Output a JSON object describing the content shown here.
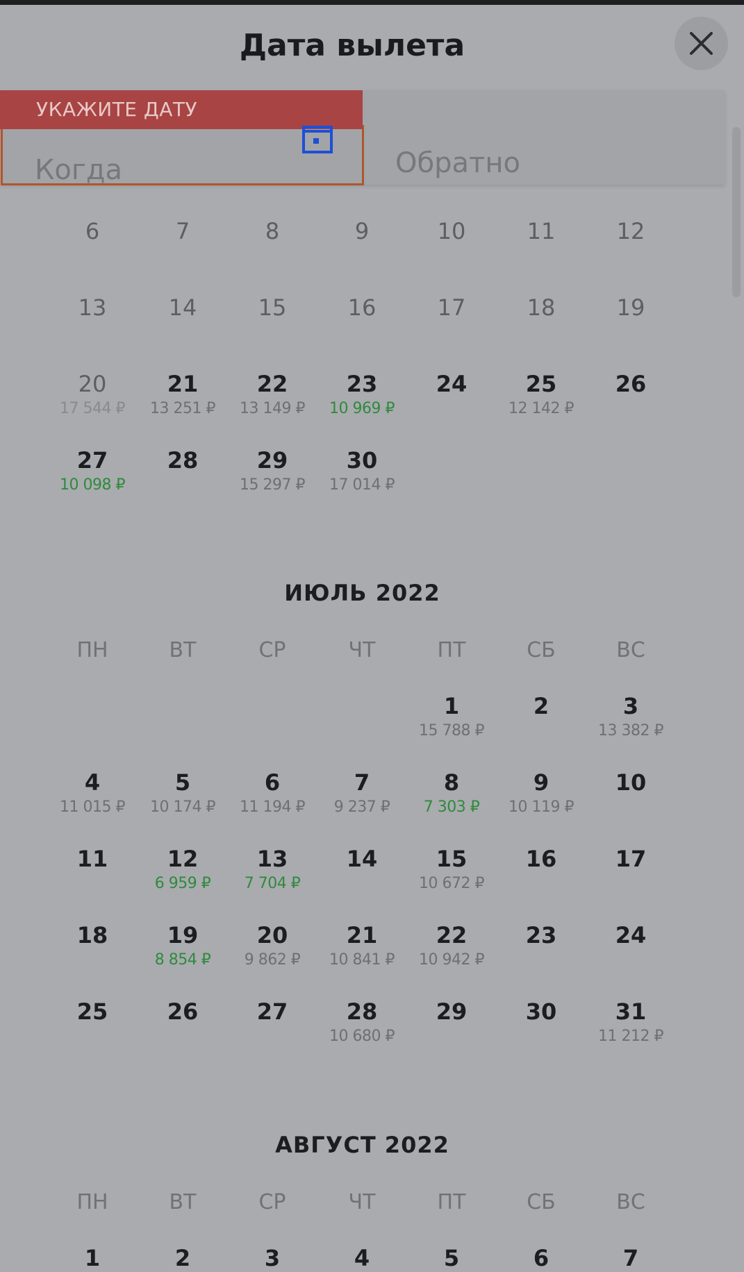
{
  "header": {
    "title": "Дата вылета",
    "close_icon": "close-icon"
  },
  "inputs": {
    "error_label": "УКАЖИТЕ ДАТУ",
    "when_placeholder": "Когда",
    "return_placeholder": "Обратно",
    "calendar_icon": "calendar-icon"
  },
  "colors": {
    "error_banner": "#a84443",
    "error_border": "#b0562d",
    "cheap_price": "#2f8a3c",
    "accent_icon": "#1d4fd7"
  },
  "june_rows": [
    [
      {
        "d": "6",
        "p": "",
        "past": true
      },
      {
        "d": "7",
        "p": "",
        "past": true
      },
      {
        "d": "8",
        "p": "",
        "past": true
      },
      {
        "d": "9",
        "p": "",
        "past": true
      },
      {
        "d": "10",
        "p": "",
        "past": true
      },
      {
        "d": "11",
        "p": "",
        "past": true
      },
      {
        "d": "12",
        "p": "",
        "past": true
      }
    ],
    [
      {
        "d": "13",
        "p": "",
        "past": true
      },
      {
        "d": "14",
        "p": "",
        "past": true
      },
      {
        "d": "15",
        "p": "",
        "past": true
      },
      {
        "d": "16",
        "p": "",
        "past": true
      },
      {
        "d": "17",
        "p": "",
        "past": true
      },
      {
        "d": "18",
        "p": "",
        "past": true
      },
      {
        "d": "19",
        "p": "",
        "past": true
      }
    ],
    [
      {
        "d": "20",
        "p": "17 544 ₽",
        "past": true,
        "ps": "faded"
      },
      {
        "d": "21",
        "p": "13 251 ₽"
      },
      {
        "d": "22",
        "p": "13 149 ₽"
      },
      {
        "d": "23",
        "p": "10 969 ₽",
        "ps": "cheap"
      },
      {
        "d": "24",
        "p": ""
      },
      {
        "d": "25",
        "p": "12 142 ₽"
      },
      {
        "d": "26",
        "p": ""
      }
    ],
    [
      {
        "d": "27",
        "p": "10 098 ₽",
        "ps": "cheap"
      },
      {
        "d": "28",
        "p": ""
      },
      {
        "d": "29",
        "p": "15 297 ₽"
      },
      {
        "d": "30",
        "p": "17 014 ₽"
      }
    ]
  ],
  "july": {
    "title": "ИЮЛЬ 2022",
    "weekdays": [
      "ПН",
      "ВТ",
      "СР",
      "ЧТ",
      "ПТ",
      "СБ",
      "ВС"
    ],
    "rows": [
      [
        null,
        null,
        null,
        null,
        {
          "d": "1",
          "p": "15 788 ₽"
        },
        {
          "d": "2",
          "p": ""
        },
        {
          "d": "3",
          "p": "13 382 ₽"
        }
      ],
      [
        {
          "d": "4",
          "p": "11 015 ₽"
        },
        {
          "d": "5",
          "p": "10 174 ₽"
        },
        {
          "d": "6",
          "p": "11 194 ₽"
        },
        {
          "d": "7",
          "p": "9 237 ₽"
        },
        {
          "d": "8",
          "p": "7 303 ₽",
          "ps": "cheap"
        },
        {
          "d": "9",
          "p": "10 119 ₽"
        },
        {
          "d": "10",
          "p": ""
        }
      ],
      [
        {
          "d": "11",
          "p": ""
        },
        {
          "d": "12",
          "p": "6 959 ₽",
          "ps": "cheap"
        },
        {
          "d": "13",
          "p": "7 704 ₽",
          "ps": "cheap"
        },
        {
          "d": "14",
          "p": ""
        },
        {
          "d": "15",
          "p": "10 672 ₽"
        },
        {
          "d": "16",
          "p": ""
        },
        {
          "d": "17",
          "p": ""
        }
      ],
      [
        {
          "d": "18",
          "p": ""
        },
        {
          "d": "19",
          "p": "8 854 ₽",
          "ps": "cheap"
        },
        {
          "d": "20",
          "p": "9 862 ₽"
        },
        {
          "d": "21",
          "p": "10 841 ₽"
        },
        {
          "d": "22",
          "p": "10 942 ₽"
        },
        {
          "d": "23",
          "p": ""
        },
        {
          "d": "24",
          "p": ""
        }
      ],
      [
        {
          "d": "25",
          "p": ""
        },
        {
          "d": "26",
          "p": ""
        },
        {
          "d": "27",
          "p": ""
        },
        {
          "d": "28",
          "p": "10 680 ₽"
        },
        {
          "d": "29",
          "p": ""
        },
        {
          "d": "30",
          "p": ""
        },
        {
          "d": "31",
          "p": "11 212 ₽"
        }
      ]
    ]
  },
  "august": {
    "title": "АВГУСТ 2022",
    "weekdays": [
      "ПН",
      "ВТ",
      "СР",
      "ЧТ",
      "ПТ",
      "СБ",
      "ВС"
    ],
    "rows": [
      [
        {
          "d": "1",
          "p": ""
        },
        {
          "d": "2",
          "p": ""
        },
        {
          "d": "3",
          "p": ""
        },
        {
          "d": "4",
          "p": ""
        },
        {
          "d": "5",
          "p": ""
        },
        {
          "d": "6",
          "p": ""
        },
        {
          "d": "7",
          "p": ""
        }
      ]
    ]
  }
}
